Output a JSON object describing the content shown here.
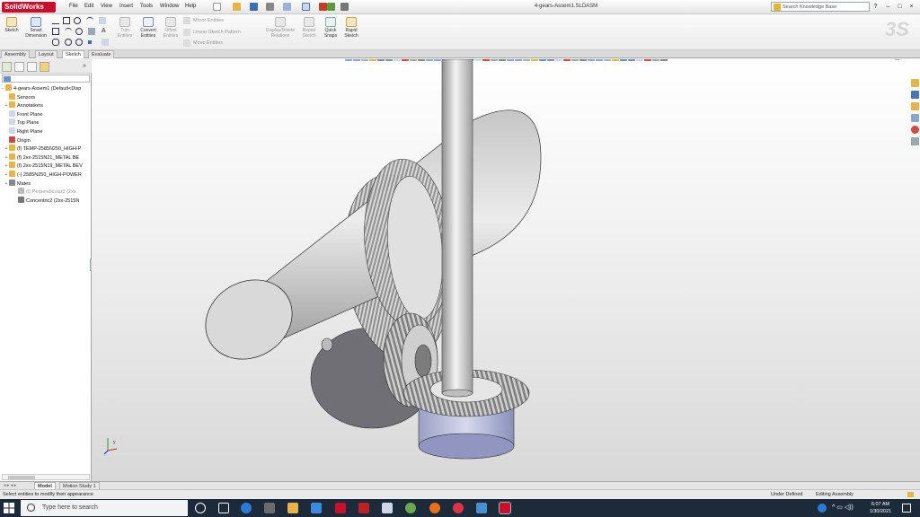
{
  "app": {
    "brand": "SolidWorks",
    "document_title": "4-gears-Assem1.SLDASM",
    "search_placeholder": "Search Knowledge Base",
    "menus": [
      "File",
      "Edit",
      "View",
      "Insert",
      "Tools",
      "Window",
      "Help"
    ],
    "help_glyph": "?"
  },
  "command_manager": {
    "buttons": {
      "sketch": "Sketch",
      "smart_dimension_1": "Smart",
      "smart_dimension_2": "Dimension",
      "trim_1": "Trim",
      "trim_2": "Entities",
      "convert_1": "Convert",
      "convert_2": "Entities",
      "offset_1": "Offset",
      "offset_2": "Entities",
      "mirror": "Mirror Entities",
      "linear_pattern": "Linear Sketch Pattern",
      "move": "Move Entities",
      "display_delete_1": "Display/Delete",
      "display_delete_2": "Relations",
      "repair_1": "Repair",
      "repair_2": "Sketch",
      "quick_snaps_1": "Quick",
      "quick_snaps_2": "Snaps",
      "rapid_1": "Rapid",
      "rapid_2": "Sketch"
    },
    "tabs": [
      "Assembly",
      "Layout",
      "Sketch",
      "Evaluate"
    ],
    "active_tab": "Sketch"
  },
  "feature_tree": {
    "root": "4-gears-Assem1 (Default<Disp",
    "items": [
      {
        "label": "Sensors",
        "dim": false,
        "icon": "sensor-icon"
      },
      {
        "label": "Annotations",
        "dim": false,
        "icon": "annotation-icon"
      },
      {
        "label": "Front Plane",
        "dim": false,
        "icon": "plane-icon"
      },
      {
        "label": "Top Plane",
        "dim": false,
        "icon": "plane-icon"
      },
      {
        "label": "Right Plane",
        "dim": false,
        "icon": "plane-icon"
      },
      {
        "label": "Origin",
        "dim": false,
        "icon": "origin-icon"
      },
      {
        "label": "(f) TEMP-2585N250_HIGH-P",
        "dim": false,
        "icon": "part-icon"
      },
      {
        "label": "(f) 2xx-2515N21_METAL BE",
        "dim": false,
        "icon": "part-icon"
      },
      {
        "label": "(f) 2xx-2515N19_METAL BEV",
        "dim": false,
        "icon": "part-icon"
      },
      {
        "label": "(-) 2585N250_HIGH-POWER",
        "dim": false,
        "icon": "part-icon"
      },
      {
        "label": "Mates",
        "dim": false,
        "icon": "mates-icon"
      },
      {
        "label": "(f) Perpendicular2 (2xx",
        "dim": true,
        "icon": "perpendicular-icon"
      },
      {
        "label": "Concentric2 (2xx-2515N",
        "dim": false,
        "icon": "concentric-icon"
      }
    ]
  },
  "bottom_tabs": [
    "Model",
    "Motion Study 1"
  ],
  "status": {
    "left": "Select entities to modify their appearance",
    "under_defined": "Under Defined",
    "mode": "Editing Assembly"
  },
  "taskbar": {
    "search_placeholder": "Type here to search",
    "time": "6:07 AM",
    "date": "1/30/2021"
  },
  "colors": {
    "brand_red": "#c8102e",
    "taskbar": "#1d2a3a",
    "tree_border": "#9ea7b3"
  }
}
